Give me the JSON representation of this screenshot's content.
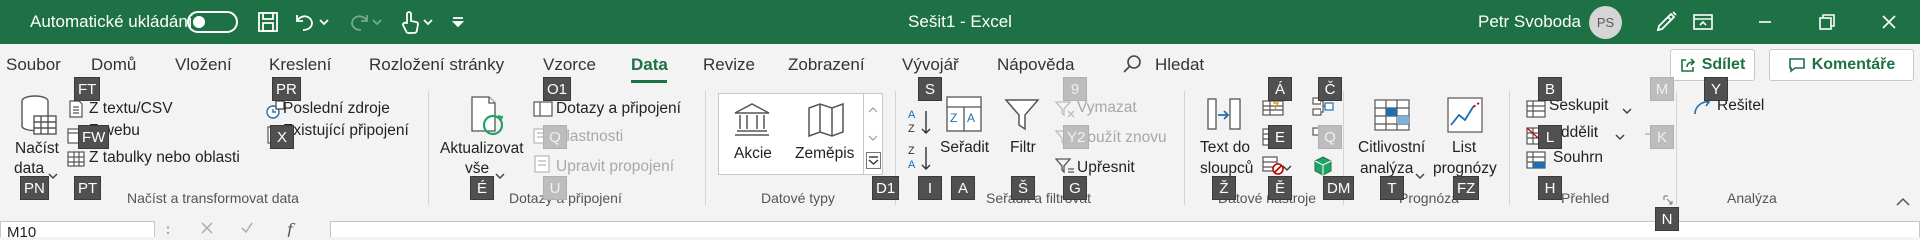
{
  "titlebar": {
    "autosave_label": "Automatické ukládání",
    "autosave_state": "off",
    "document_title": "Sešit1  -  Excel",
    "user_name": "Petr Svoboda",
    "user_initials": "PS",
    "bg_color": "#1e7145",
    "icons": [
      "save-icon",
      "undo-icon",
      "redo-icon",
      "touch-mode-icon",
      "customize-qat-icon",
      "pen-icon",
      "ribbon-display-icon",
      "minimize-icon",
      "restore-icon",
      "close-icon"
    ]
  },
  "tabs": [
    {
      "label": "Soubor"
    },
    {
      "label": "Domů"
    },
    {
      "label": "Vložení"
    },
    {
      "label": "Kreslení"
    },
    {
      "label": "Rozložení stránky"
    },
    {
      "label": "Vzorce"
    },
    {
      "label": "Data",
      "active": true
    },
    {
      "label": "Revize"
    },
    {
      "label": "Zobrazení"
    },
    {
      "label": "Vývojář"
    },
    {
      "label": "Nápověda"
    }
  ],
  "search_label": "Hledat",
  "share_label": "Sdílet",
  "comments_label": "Komentáře",
  "groups": {
    "get_data": {
      "label": "Načíst a transformovat data",
      "nacist_line1": "Načíst",
      "nacist_line2": "data",
      "from_text": "Z textu/CSV",
      "from_web": "Z webu",
      "from_table": "Z tabulky nebo oblasti",
      "recent": "Poslední zdroje",
      "existing": "Existující připojení"
    },
    "queries": {
      "label": "Dotazy a připojení",
      "refresh_line1": "Aktualizovat",
      "refresh_line2": "vše",
      "queries_conn": "Dotazy a připojení",
      "properties": "Vlastnosti",
      "edit_links": "Upravit propojení"
    },
    "data_types": {
      "label": "Datové typy",
      "stocks": "Akcie",
      "geography": "Zeměpis"
    },
    "sort_filter": {
      "label": "Seřadit a filtrovat",
      "sort": "Seřadit",
      "filter": "Filtr",
      "clear": "Vymazat",
      "reapply": "Použít znovu",
      "advanced": "Upřesnit"
    },
    "data_tools": {
      "label": "Datové nástroje",
      "text_to_cols_1": "Text do",
      "text_to_cols_2": "sloupců"
    },
    "forecast": {
      "label": "Prognóza",
      "whatif_1": "Citlivostní",
      "whatif_2": "analýza",
      "sheet_1": "List",
      "sheet_2": "prognózy"
    },
    "outline": {
      "label": "Přehled",
      "group": "Seskupit",
      "ungroup": "Oddělit",
      "subtotal": "Souhrn"
    },
    "analysis": {
      "label": "Analýza",
      "solver": "Řešitel"
    }
  },
  "keytips": {
    "FT": "FT",
    "FW": "FW",
    "PT": "PT",
    "PN": "PN",
    "PR": "PR",
    "X": "X",
    "O1": "O1",
    "Q": "Q",
    "E_refresh": "É",
    "U": "U",
    "D1": "D1",
    "S": "S",
    "I": "I",
    "A": "A",
    "Sh": "Š",
    "9": "9",
    "Y2": "Y2",
    "G": "G",
    "Ah": "Á",
    "Cc": "Č",
    "E": "E",
    "Q2": "Q",
    "Zc": "Ž",
    "Ec": "Ě",
    "DM": "DM",
    "T": "T",
    "FZ": "FZ",
    "B": "B",
    "M": "M",
    "L": "L",
    "K": "K",
    "H": "H",
    "N": "N",
    "Y": "Y"
  },
  "formula_bar": {
    "namebox": "M10",
    "fx": "f"
  }
}
